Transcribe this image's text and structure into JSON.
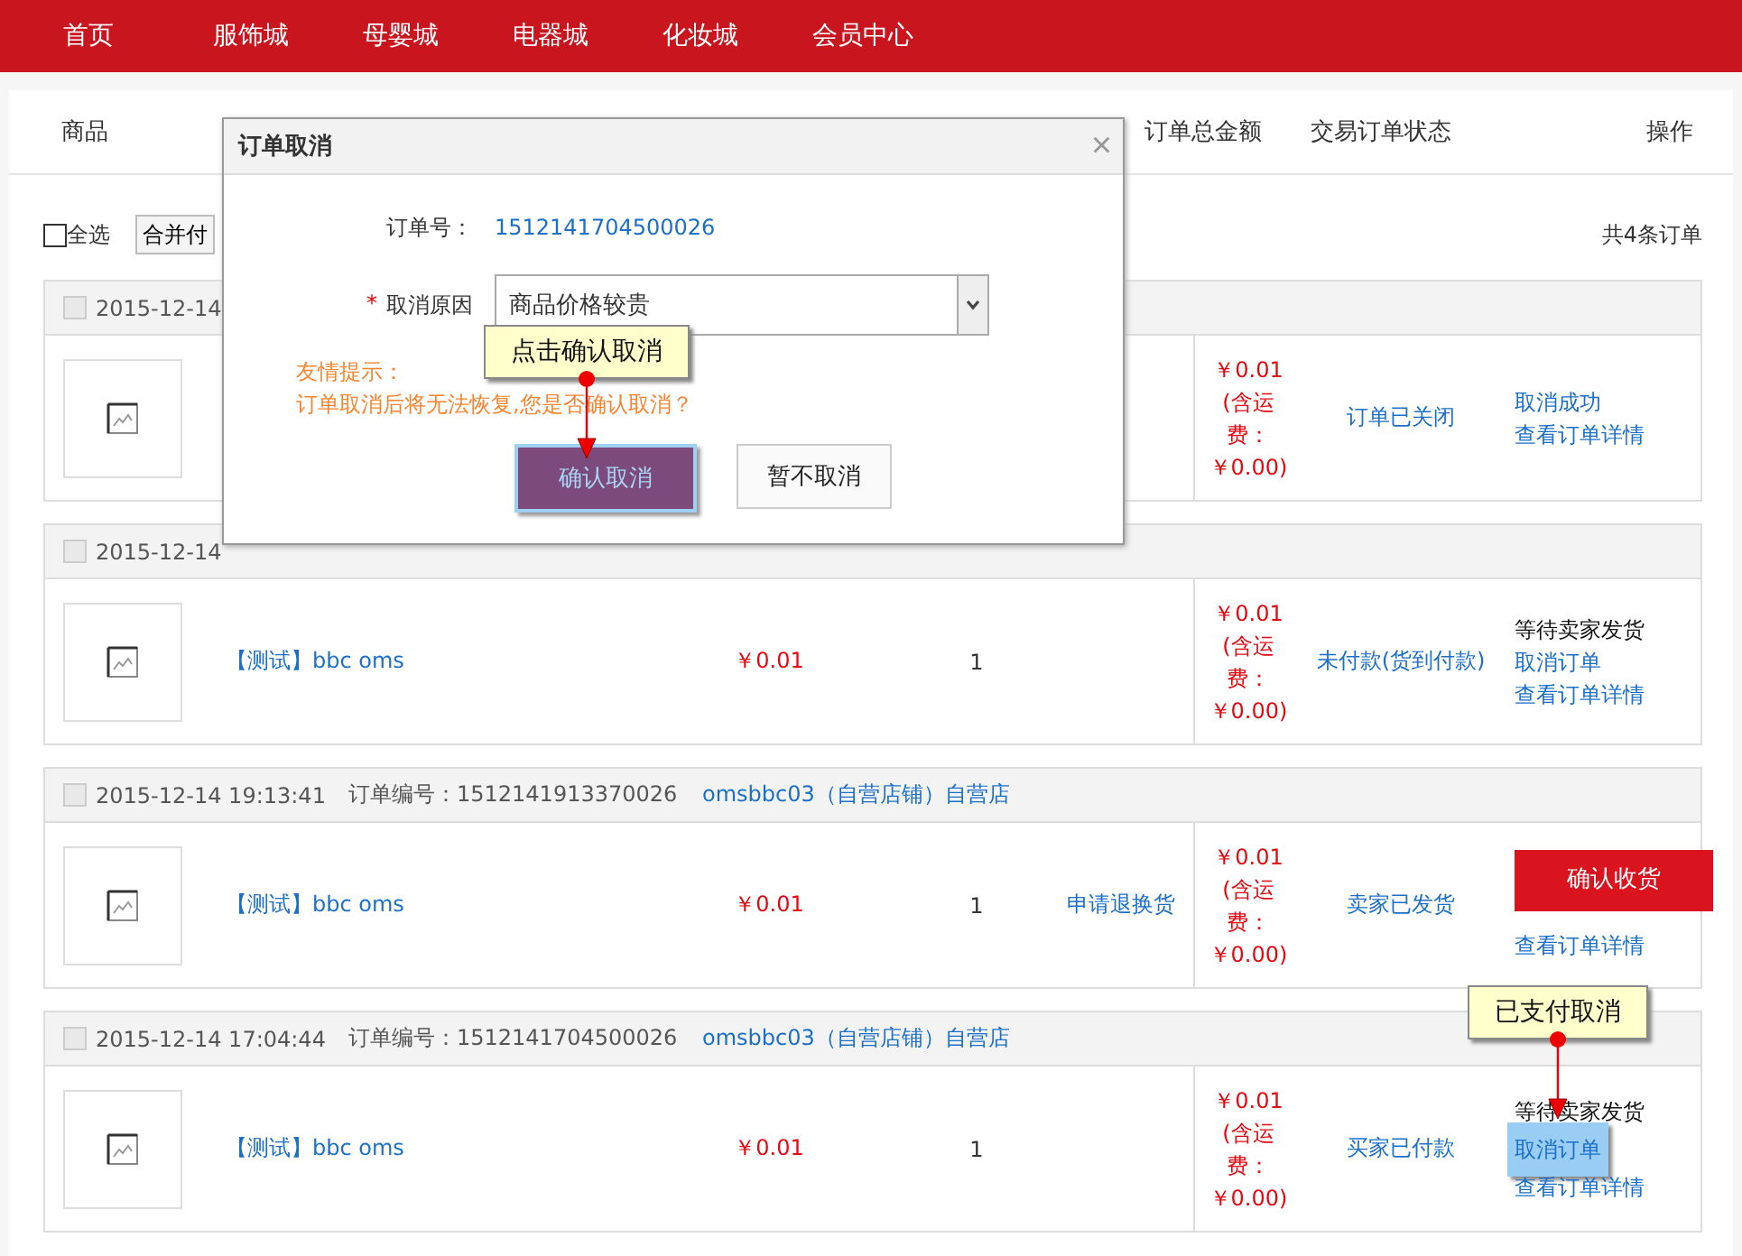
{
  "nav": [
    {
      "label": "首页"
    },
    {
      "label": "服饰城"
    },
    {
      "label": "母婴城"
    },
    {
      "label": "电器城"
    },
    {
      "label": "化妆城"
    },
    {
      "label": "会员中心"
    }
  ],
  "table_header": {
    "product": "商品",
    "amount": "订单总金额",
    "status": "交易订单状态",
    "actions": "操作"
  },
  "toolbar": {
    "select_all": {
      "label": "全选",
      "checked": false
    },
    "merge_button": "合并付",
    "count": "共4条订单"
  },
  "orders": [
    {
      "checked": false,
      "date": "2015-12-14",
      "amount": "￥0.01",
      "shipping_note": "(含运费：￥0.00)",
      "status": "订单已关闭",
      "actions": [
        {
          "kind": "link",
          "label": "取消成功",
          "highlighted": false
        },
        {
          "kind": "link",
          "label": "查看订单详情",
          "highlighted": false
        }
      ]
    },
    {
      "checked": false,
      "date": "2015-12-14",
      "product": "【测试】bbc oms",
      "price": "￥0.01",
      "qty": "1",
      "amount": "￥0.01",
      "shipping_note": "(含运费：￥0.00)",
      "status": "未付款(货到付款)",
      "actions": [
        {
          "kind": "text",
          "label": "等待卖家发货",
          "highlighted": false
        },
        {
          "kind": "link",
          "label": "取消订单",
          "highlighted": false
        },
        {
          "kind": "link",
          "label": "查看订单详情",
          "highlighted": false
        }
      ]
    },
    {
      "checked": false,
      "date": "2015-12-14 19:13:41",
      "order_no": "订单编号：1512141913370026",
      "shop": "omsbbc03（自营店铺）自营店",
      "product": "【测试】bbc oms",
      "price": "￥0.01",
      "qty": "1",
      "after_sale": "申请退换货",
      "amount": "￥0.01",
      "shipping_note": "(含运费：￥0.00)",
      "status": "卖家已发货",
      "actions": [
        {
          "kind": "button",
          "label": "确认收货",
          "highlighted": false
        },
        {
          "kind": "link",
          "label": "查看订单详情",
          "highlighted": false
        }
      ]
    },
    {
      "checked": false,
      "date": "2015-12-14 17:04:44",
      "order_no": "订单编号：1512141704500026",
      "shop": "omsbbc03（自营店铺）自营店",
      "product": "【测试】bbc oms",
      "price": "￥0.01",
      "qty": "1",
      "amount": "￥0.01",
      "shipping_note": "(含运费：￥0.00)",
      "status": "买家已付款",
      "actions": [
        {
          "kind": "text",
          "label": "等待卖家发货",
          "highlighted": false
        },
        {
          "kind": "link",
          "label": "取消订单",
          "highlighted": true
        },
        {
          "kind": "link",
          "label": "查看订单详情",
          "highlighted": false
        }
      ]
    }
  ],
  "dialog": {
    "title": "订单取消",
    "close": "×",
    "order_label": "订单号：",
    "order_no": "1512141704500026",
    "required_mark": "*",
    "reason_label": "取消原因",
    "reason_value": "商品价格较贵",
    "tip_title": "友情提示：",
    "tip_text": "订单取消后将无法恢复,您是否确认取消？",
    "confirm_button": "确认取消",
    "cancel_button": "暂不取消"
  },
  "callouts": [
    {
      "text": "点击确认取消"
    },
    {
      "text": "已支付取消"
    }
  ]
}
